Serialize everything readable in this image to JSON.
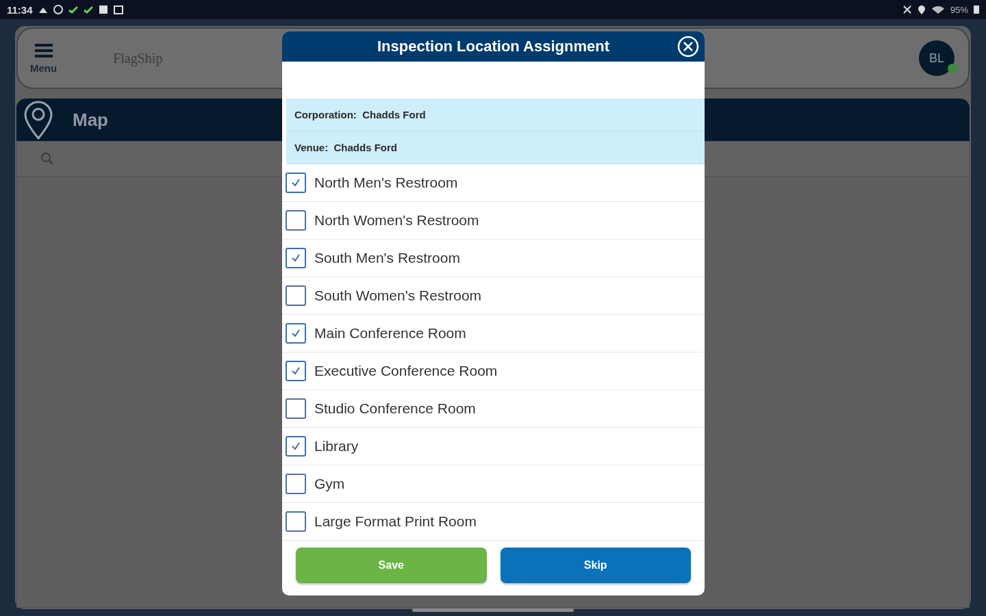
{
  "status_bar": {
    "time": "11:34",
    "battery": "95%"
  },
  "header": {
    "menu_label": "Menu",
    "logo": "FlagShip",
    "avatar": "BL",
    "online": true
  },
  "page": {
    "title": "Map"
  },
  "dialog": {
    "title": "Inspection Location Assignment",
    "info": [
      {
        "label": "Corporation:",
        "value": "Chadds Ford"
      },
      {
        "label": "Venue:",
        "value": "Chadds Ford"
      }
    ],
    "locations": [
      {
        "name": "North Men's Restroom",
        "checked": true
      },
      {
        "name": "North Women's Restroom",
        "checked": false
      },
      {
        "name": "South Men's Restroom",
        "checked": true
      },
      {
        "name": "South Women's Restroom",
        "checked": false
      },
      {
        "name": "Main Conference Room",
        "checked": true
      },
      {
        "name": "Executive Conference Room",
        "checked": true
      },
      {
        "name": "Studio Conference Room",
        "checked": false
      },
      {
        "name": "Library",
        "checked": true
      },
      {
        "name": "Gym",
        "checked": false
      },
      {
        "name": "Large Format Print Room",
        "checked": false
      }
    ],
    "buttons": [
      {
        "label": "Save",
        "kind": "save"
      },
      {
        "label": "Skip",
        "kind": "skip"
      }
    ]
  }
}
